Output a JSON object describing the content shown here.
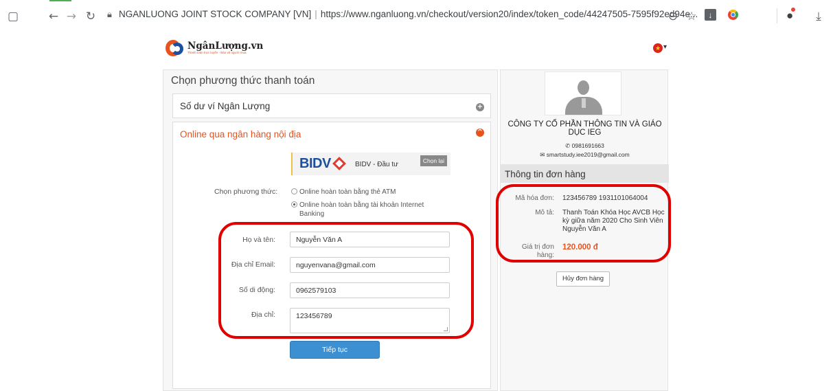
{
  "browser": {
    "site_owner": "NGANLUONG JOINT STOCK COMPANY [VN]",
    "url": "https://www.nganluong.vn/checkout/version20/index/token_code/44247505-7595f92ed94e...",
    "icons": [
      "tab-icon",
      "back-icon",
      "forward-icon",
      "reload-icon",
      "lock-icon",
      "zoom-icon",
      "star-icon",
      "download-extension-icon",
      "chrome-extension-icon",
      "profile-icon",
      "download-icon"
    ]
  },
  "logo": {
    "name": "NgânLượng.vn",
    "tagline": "Thanh toán trực tuyến - Bảo vệ người mua"
  },
  "left": {
    "heading": "Chọn phương thức thanh toán",
    "wallet_label": "Số dư ví Ngân Lượng",
    "bank_label": "Online qua ngân hàng nội địa",
    "bank": {
      "logo": "BIDV",
      "name": "BIDV - Đầu tư",
      "reselect": "Chọn lại"
    },
    "method_label": "Chọn phương thức:",
    "methods": [
      {
        "label": "Online hoàn toàn bằng thẻ ATM",
        "checked": false
      },
      {
        "label": "Online hoàn toàn bằng tài khoản Internet Banking",
        "checked": true
      }
    ],
    "form": {
      "name_label": "Họ và tên:",
      "name_value": "Nguyễn Văn A",
      "email_label": "Địa chỉ Email:",
      "email_value": "nguyenvana@gmail.com",
      "phone_label": "Số di động:",
      "phone_value": "0962579103",
      "address_label": "Địa chỉ:",
      "address_value": "123456789",
      "submit_label": "Tiếp tục"
    }
  },
  "right": {
    "company": "CÔNG TY CỔ PHẦN THÔNG TIN VÀ GIÁO DỤC IEG",
    "phone": "0981691663",
    "email": "smartstudy.iee2019@gmail.com",
    "section_title": "Thông tin đơn hàng",
    "order_code_label": "Mã hóa đơn:",
    "order_code_value": "123456789 1931101064004",
    "desc_label": "Mô tả:",
    "desc_value": "Thanh Toán Khóa Học AVCB Học kỳ giữa năm 2020 Cho Sinh Viên Nguyễn Văn A",
    "price_label": "Giá trị đơn hàng:",
    "price_value": "120.000 đ",
    "cancel_label": "Hủy đơn hàng"
  },
  "colors": {
    "accent": "#e8531d",
    "button": "#3c8fd0",
    "highlight": "#e00000",
    "bank_blue": "#1e4f9c"
  }
}
